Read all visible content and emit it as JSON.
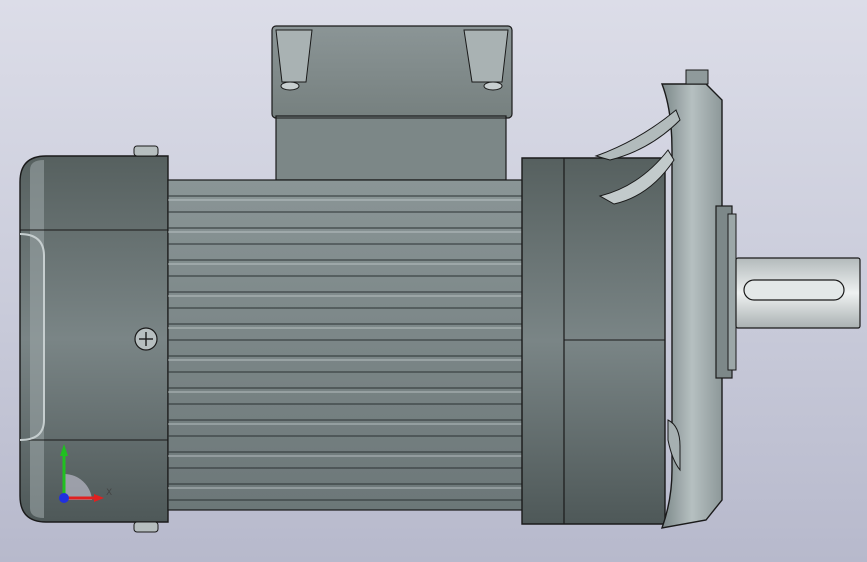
{
  "viewport": {
    "background_top": "#dcdde8",
    "background_bottom": "#b7b9cc"
  },
  "model": {
    "body_color": "#6a7576",
    "body_dark": "#4a5354",
    "flange_color": "#9aa6a8",
    "shaft_color": "#d4dadb",
    "edge_color": "#1a1a1a"
  },
  "triad": {
    "x_label": "X",
    "x_color": "#e02020",
    "y_color": "#20c020",
    "z_color": "#2030e0",
    "icons": [
      "view-orientation-triad-icon"
    ]
  }
}
